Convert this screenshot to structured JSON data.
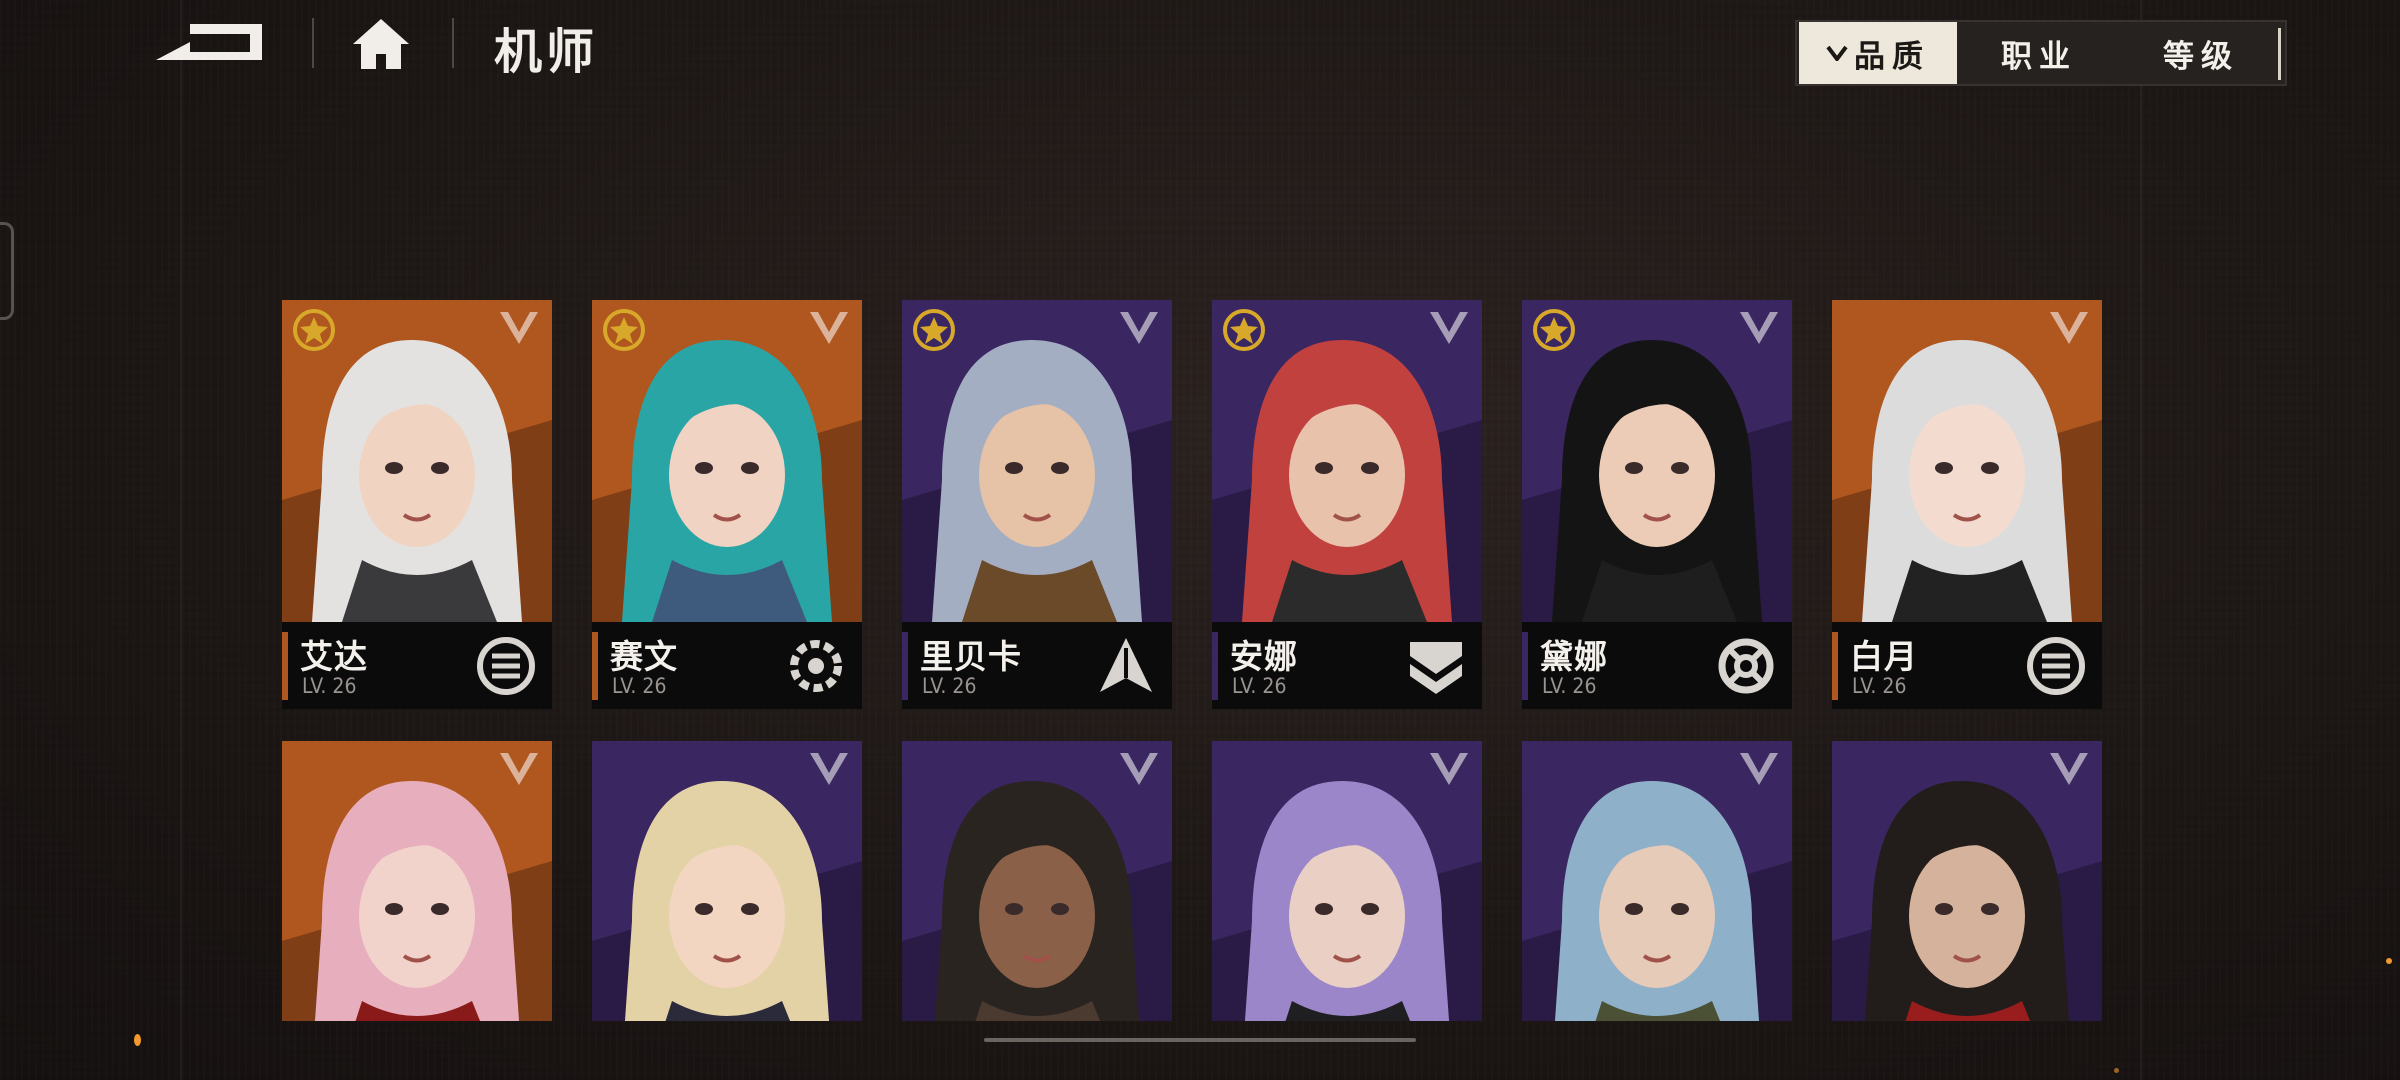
{
  "header": {
    "title": "机师",
    "back_icon": "back-arrow-icon",
    "home_icon": "home-icon"
  },
  "filters": [
    {
      "label": "品质",
      "active": true,
      "indicator": "chevron-down-icon"
    },
    {
      "label": "职业",
      "active": false
    },
    {
      "label": "等级",
      "active": false
    }
  ],
  "pilots": [
    {
      "name": "艾达",
      "level": "LV. 26",
      "tier": "orange",
      "starred": true,
      "class_icon": "guardian-class-icon",
      "hair": "#e4e2e0",
      "skin": "#f0d3c1",
      "outfit": "#3a3a3c"
    },
    {
      "name": "赛文",
      "level": "LV. 26",
      "tier": "orange",
      "starred": true,
      "class_icon": "engineer-class-icon",
      "hair": "#2aa5a6",
      "skin": "#f1d3c3",
      "outfit": "#3e5b7e"
    },
    {
      "name": "里贝卡",
      "level": "LV. 26",
      "tier": "purple",
      "starred": true,
      "class_icon": "sniper-class-icon",
      "hair": "#a3aec3",
      "skin": "#e6c2a6",
      "outfit": "#6b4a2a"
    },
    {
      "name": "安娜",
      "level": "LV. 26",
      "tier": "purple",
      "starred": true,
      "class_icon": "assault-class-icon",
      "hair": "#c1413f",
      "skin": "#e9c2ab",
      "outfit": "#2b2b2b"
    },
    {
      "name": "黛娜",
      "level": "LV. 26",
      "tier": "purple",
      "starred": true,
      "class_icon": "support-class-icon",
      "hair": "#141414",
      "skin": "#ecccb7",
      "outfit": "#1e1e1e"
    },
    {
      "name": "白月",
      "level": "LV. 26",
      "tier": "orange",
      "starred": false,
      "class_icon": "guardian-class-icon",
      "hair": "#dcdcdc",
      "skin": "#f3dccf",
      "outfit": "#222222"
    },
    {
      "tier": "orange",
      "hair": "#e7aebd",
      "skin": "#f2d3cb",
      "outfit": "#8a1a1a"
    },
    {
      "tier": "purple",
      "hair": "#e3d2a6",
      "skin": "#f2d6c1",
      "outfit": "#2a2a3a"
    },
    {
      "tier": "purple",
      "hair": "#2a2420",
      "skin": "#8a6048",
      "outfit": "#4a3a30"
    },
    {
      "tier": "purple",
      "hair": "#9a86c8",
      "skin": "#ead0c4",
      "outfit": "#1f1f22"
    },
    {
      "tier": "purple",
      "hair": "#8fb0c9",
      "skin": "#e6cbb9",
      "outfit": "#4a5134"
    },
    {
      "tier": "purple",
      "hair": "#221c1a",
      "skin": "#d5b29b",
      "outfit": "#9a1d1d"
    }
  ],
  "colors": {
    "orange_tier": "#b0561f",
    "purple_tier": "#3a2660",
    "star_badge": "#d7a82a"
  }
}
